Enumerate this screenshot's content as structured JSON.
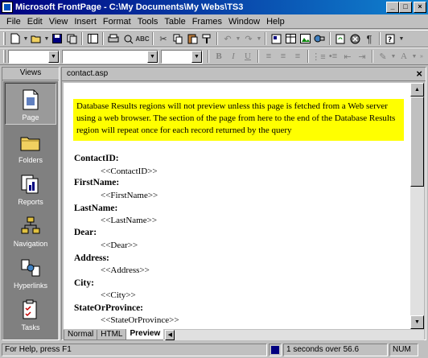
{
  "window": {
    "title": "Microsoft FrontPage - C:\\My Documents\\My Webs\\TS3"
  },
  "menu": [
    "File",
    "Edit",
    "View",
    "Insert",
    "Format",
    "Tools",
    "Table",
    "Frames",
    "Window",
    "Help"
  ],
  "toolbar": {
    "font_combo": "",
    "style_combo": "",
    "size_combo": "",
    "bold": "B",
    "italic": "I",
    "underline": "U"
  },
  "views": {
    "header": "Views",
    "items": [
      {
        "label": "Page",
        "icon": "page-icon",
        "active": true
      },
      {
        "label": "Folders",
        "icon": "folder-icon",
        "active": false
      },
      {
        "label": "Reports",
        "icon": "reports-icon",
        "active": false
      },
      {
        "label": "Navigation",
        "icon": "navigation-icon",
        "active": false
      },
      {
        "label": "Hyperlinks",
        "icon": "hyperlinks-icon",
        "active": false
      },
      {
        "label": "Tasks",
        "icon": "tasks-icon",
        "active": false
      }
    ]
  },
  "document": {
    "filename": "contact.asp",
    "notice": "Database Results regions will not preview unless this page is fetched from a Web server using a web browser. The section of the page from here to the end of the Database Results region will repeat once for each record returned by the query",
    "fields": [
      {
        "label": "ContactID:",
        "value": "<<ContactID>>"
      },
      {
        "label": "FirstName:",
        "value": "<<FirstName>>"
      },
      {
        "label": "LastName:",
        "value": "<<LastName>>"
      },
      {
        "label": "Dear:",
        "value": "<<Dear>>"
      },
      {
        "label": "Address:",
        "value": "<<Address>>"
      },
      {
        "label": "City:",
        "value": "<<City>>"
      },
      {
        "label": "StateOrProvince:",
        "value": "<<StateOrProvince>>"
      }
    ],
    "tabs": [
      "Normal",
      "HTML",
      "Preview"
    ],
    "active_tab": "Preview"
  },
  "statusbar": {
    "help": "For Help, press F1",
    "timing": "1 seconds over 56.6",
    "mode": "NUM"
  }
}
